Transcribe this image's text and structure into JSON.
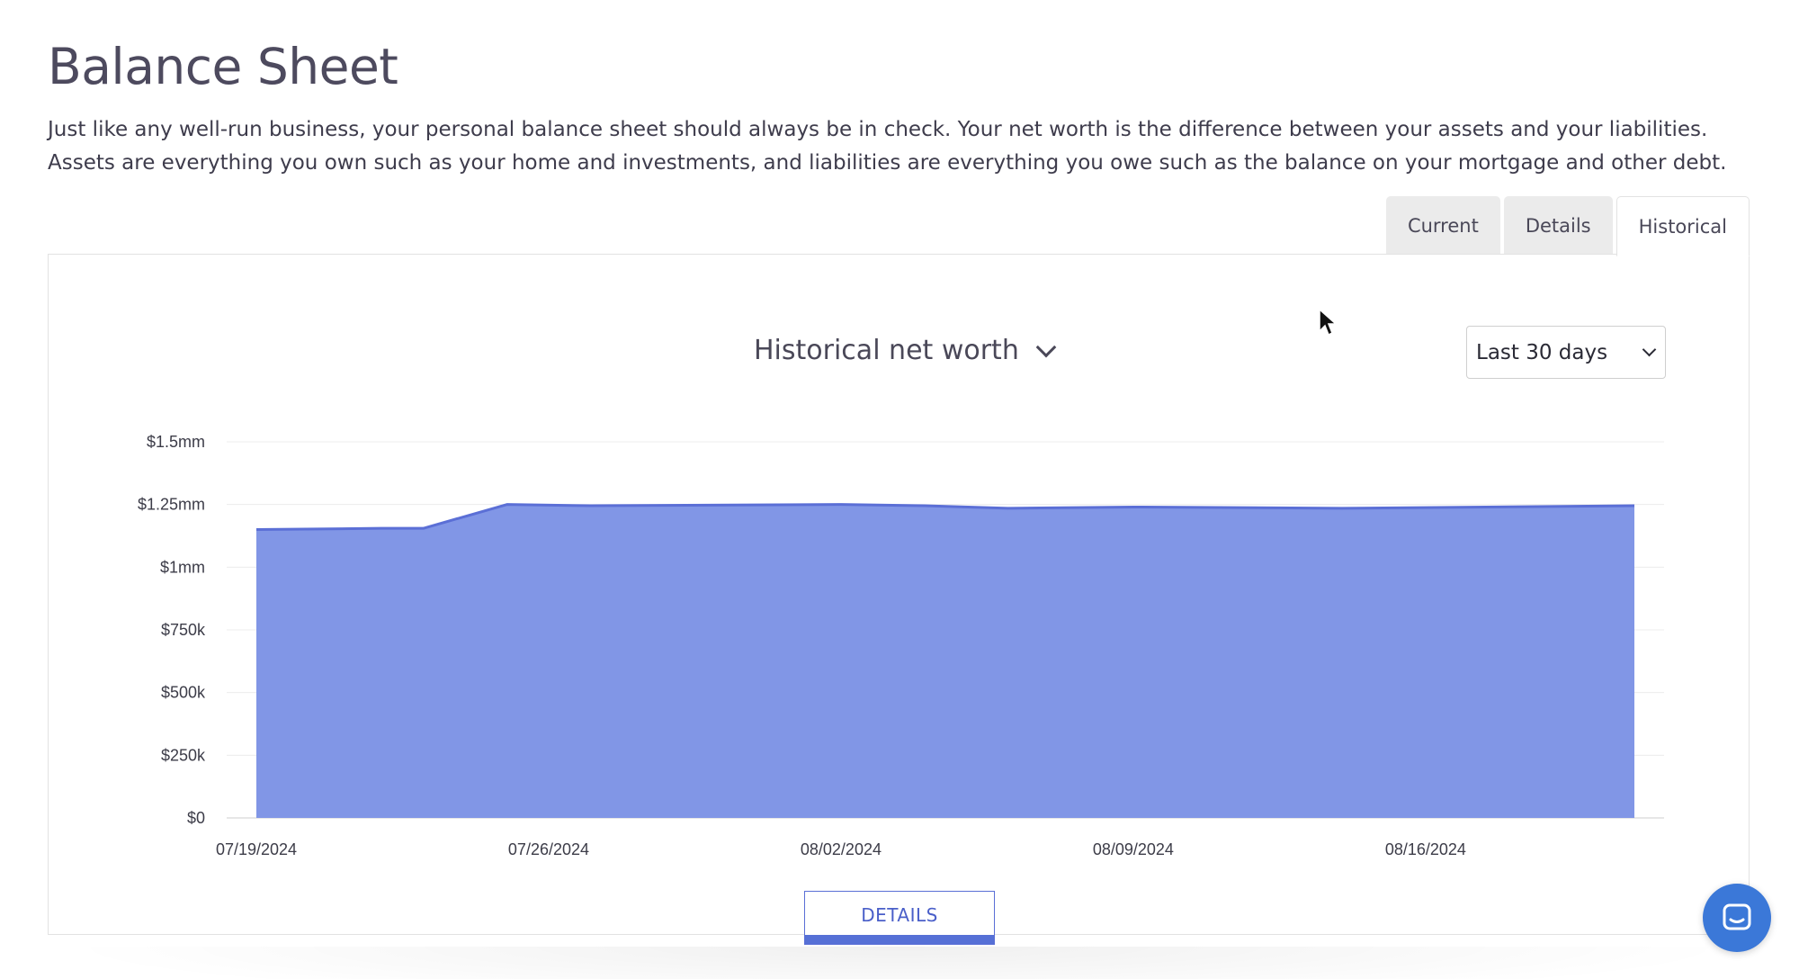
{
  "page": {
    "title": "Balance Sheet",
    "intro": "Just like any well-run business, your personal balance sheet should always be in check. Your net worth is the difference between your assets and your liabilities. Assets are everything you own such as your home and investments, and liabilities are everything you owe such as the balance on your mortgage and other debt."
  },
  "tabs": [
    {
      "label": "Current",
      "active": false
    },
    {
      "label": "Details",
      "active": false
    },
    {
      "label": "Historical",
      "active": true
    }
  ],
  "chart_header": {
    "title": "Historical net worth",
    "icon": "chevron-down-icon"
  },
  "range_select": {
    "value": "Last 30 days",
    "icon": "chevron-down-icon"
  },
  "details_button": {
    "label": "DETAILS"
  },
  "chat": {
    "icon": "chat-icon"
  },
  "colors": {
    "area_fill": "#8196e6",
    "area_line": "#5b6fd6",
    "accent": "#5670d6",
    "chat": "#3b78d8"
  },
  "chart_data": {
    "type": "area",
    "title": "Historical net worth",
    "xlabel": "",
    "ylabel": "",
    "grid": true,
    "legend": "none",
    "x_ticks": [
      "07/19/2024",
      "07/26/2024",
      "08/02/2024",
      "08/09/2024",
      "08/16/2024"
    ],
    "y_ticks": [
      "$0",
      "$250k",
      "$500k",
      "$750k",
      "$1mm",
      "$1.25mm",
      "$1.5mm"
    ],
    "ylim": [
      0,
      1500000
    ],
    "x_range": [
      "07/19/2024",
      "08/21/2024"
    ],
    "series": [
      {
        "x": [
          "07/19/2024",
          "07/22/2024",
          "07/23/2024",
          "07/25/2024",
          "07/27/2024",
          "08/02/2024",
          "08/04/2024",
          "08/06/2024",
          "08/09/2024",
          "08/14/2024",
          "08/21/2024"
        ],
        "values": [
          1150000,
          1155000,
          1155000,
          1250000,
          1245000,
          1250000,
          1245000,
          1235000,
          1240000,
          1235000,
          1245000
        ]
      }
    ]
  }
}
